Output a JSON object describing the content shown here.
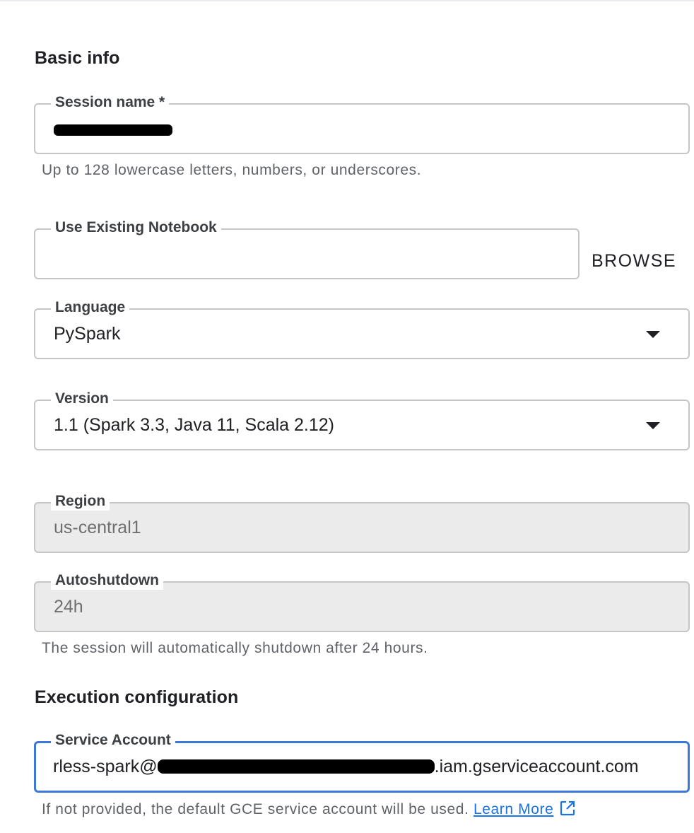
{
  "sections": {
    "basic_info": "Basic info",
    "execution_config": "Execution configuration"
  },
  "session_name": {
    "label": "Session name *",
    "value": "",
    "redacted": true,
    "helper": "Up to 128 lowercase letters, numbers, or underscores."
  },
  "notebook": {
    "label": "Use Existing Notebook",
    "value": "",
    "browse_label": "BROWSE"
  },
  "language": {
    "label": "Language",
    "value": "PySpark"
  },
  "version": {
    "label": "Version",
    "value": "1.1 (Spark 3.3, Java 11, Scala 2.12)"
  },
  "region": {
    "label": "Region",
    "value": "us-central1"
  },
  "autoshutdown": {
    "label": "Autoshutdown",
    "value": "24h",
    "helper": "The session will automatically shutdown after 24 hours."
  },
  "service_account": {
    "label": "Service Account",
    "value_prefix": "rless-spark@",
    "value_suffix": ".iam.gserviceaccount.com",
    "helper": "If not provided, the default GCE service account will be used.",
    "learn_more": "Learn More"
  },
  "icons": {
    "dropdown": "chevron-down-icon",
    "external_link": "external-link-icon"
  },
  "colors": {
    "focus_border": "#3c78d8",
    "link": "#1a73e8",
    "disabled_bg": "#ebebeb"
  }
}
